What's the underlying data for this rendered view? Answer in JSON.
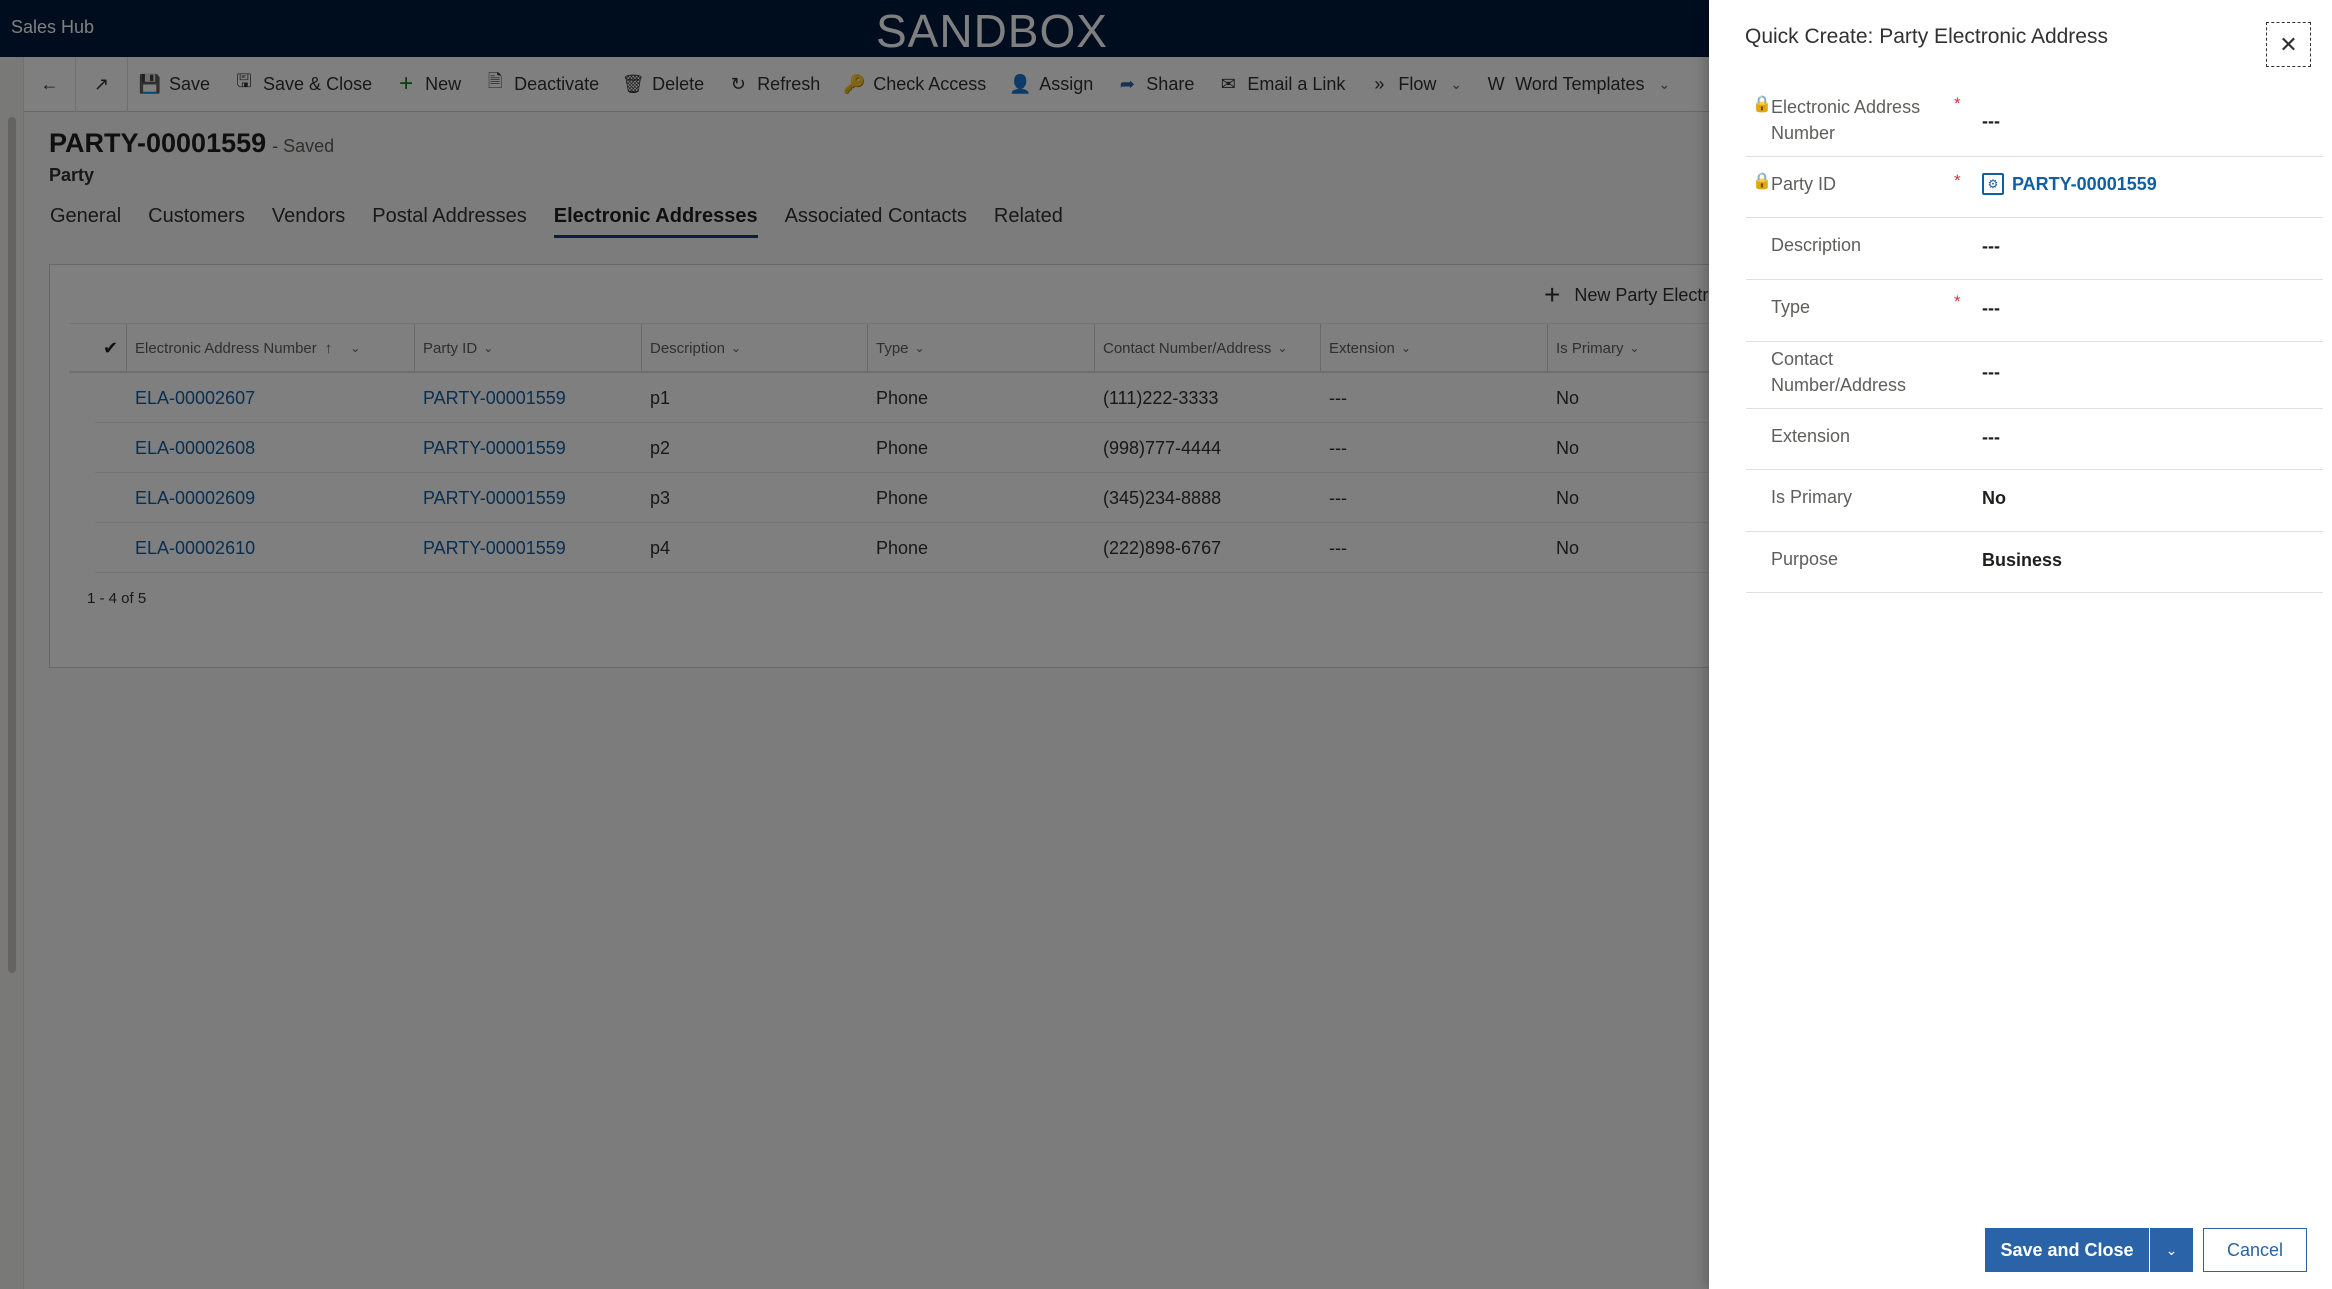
{
  "topbar": {
    "app_name": "Sales Hub",
    "environment_banner": "SANDBOX"
  },
  "toolbar": {
    "buttons": [
      {
        "label": "Save",
        "icon": "save-icon"
      },
      {
        "label": "Save & Close",
        "icon": "save-close-icon"
      },
      {
        "label": "New",
        "icon": "plus-icon"
      },
      {
        "label": "Deactivate",
        "icon": "deactivate-icon"
      },
      {
        "label": "Delete",
        "icon": "trash-icon"
      },
      {
        "label": "Refresh",
        "icon": "refresh-icon"
      },
      {
        "label": "Check Access",
        "icon": "key-icon"
      },
      {
        "label": "Assign",
        "icon": "person-icon"
      },
      {
        "label": "Share",
        "icon": "share-icon"
      },
      {
        "label": "Email a Link",
        "icon": "email-icon"
      },
      {
        "label": "Flow",
        "icon": "flow-icon"
      },
      {
        "label": "Word Templates",
        "icon": "word-icon"
      }
    ]
  },
  "record": {
    "title": "PARTY-00001559",
    "status": "- Saved",
    "entity": "Party"
  },
  "tabs": [
    {
      "label": "General"
    },
    {
      "label": "Customers"
    },
    {
      "label": "Vendors"
    },
    {
      "label": "Postal Addresses"
    },
    {
      "label": "Electronic Addresses",
      "active": true
    },
    {
      "label": "Associated Contacts"
    },
    {
      "label": "Related"
    }
  ],
  "subgrid": {
    "new_button_label": "New Party Electro",
    "columns": [
      {
        "label": "Electronic Address Number",
        "sorted": "ascending"
      },
      {
        "label": "Party ID"
      },
      {
        "label": "Description"
      },
      {
        "label": "Type"
      },
      {
        "label": "Contact Number/Address"
      },
      {
        "label": "Extension"
      },
      {
        "label": "Is Primary"
      }
    ],
    "rows": [
      {
        "number": "ELA-00002607",
        "party": "PARTY-00001559",
        "description": "p1",
        "type": "Phone",
        "contact": "(111)222-3333",
        "extension": "---",
        "primary": "No"
      },
      {
        "number": "ELA-00002608",
        "party": "PARTY-00001559",
        "description": "p2",
        "type": "Phone",
        "contact": "(998)777-4444",
        "extension": "---",
        "primary": "No"
      },
      {
        "number": "ELA-00002609",
        "party": "PARTY-00001559",
        "description": "p3",
        "type": "Phone",
        "contact": "(345)234-8888",
        "extension": "---",
        "primary": "No"
      },
      {
        "number": "ELA-00002610",
        "party": "PARTY-00001559",
        "description": "p4",
        "type": "Phone",
        "contact": "(222)898-6767",
        "extension": "---",
        "primary": "No"
      }
    ],
    "pager": "1 - 4 of 5"
  },
  "quick_create": {
    "title": "Quick Create: Party Electronic Address",
    "fields": [
      {
        "label": "Electronic Address Number",
        "value": "---",
        "locked": true,
        "required": true
      },
      {
        "label": "Party ID",
        "value": "PARTY-00001559",
        "locked": true,
        "required": true,
        "lookup": true
      },
      {
        "label": "Description",
        "value": "---"
      },
      {
        "label": "Type",
        "value": "---",
        "required": true
      },
      {
        "label": "Contact Number/Address",
        "value": "---"
      },
      {
        "label": "Extension",
        "value": "---"
      },
      {
        "label": "Is Primary",
        "value": "No"
      },
      {
        "label": "Purpose",
        "value": "Business"
      }
    ],
    "save_close_label": "Save and Close",
    "cancel_label": "Cancel"
  },
  "colors": {
    "accent": "#2b63a8",
    "link": "#115ea3",
    "required": "#d13438",
    "topbar": "#001a3e",
    "tab_underline": "#1f3b86"
  }
}
